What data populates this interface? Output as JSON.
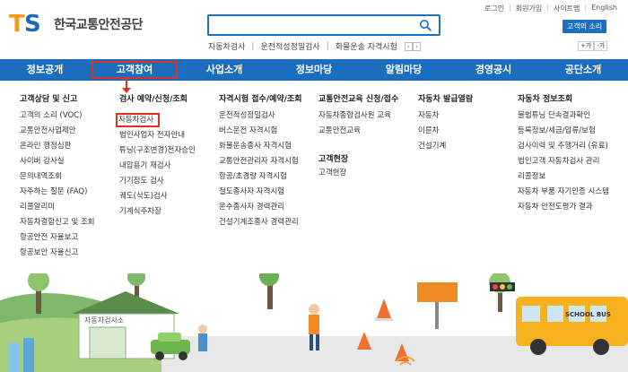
{
  "header": {
    "logo_mark_t": "T",
    "logo_mark_s": "S",
    "logo_text": "한국교통안전공단",
    "search_placeholder": "",
    "keywords": [
      "자동차검사",
      "운전적성정밀검사",
      "화물운송 자격시험"
    ],
    "util_links": [
      "로그인",
      "회원가입",
      "사이트맵",
      "English"
    ],
    "voice_button": "고객의 소리",
    "font_plus": "+가",
    "font_minus": "-가"
  },
  "nav": {
    "items": [
      "정보공개",
      "고객참여",
      "사업소개",
      "정보마당",
      "알림마당",
      "경영공시",
      "공단소개"
    ],
    "active_index": 1
  },
  "mega": {
    "col1": {
      "title": "고객상담 및 신고",
      "items": [
        "고객의 소리 (VOC)",
        "교통안전사업제안",
        "온라인 행정심판",
        "사이버 감사실",
        "문의내역조회",
        "자주하는 질문 (FAQ)",
        "리콜알리미",
        "자동차결함신고 및 조회",
        "항공안전 자율보고",
        "항공보안 자율신고"
      ]
    },
    "col2": {
      "title": "검사 예약/신청/조회",
      "items": [
        "자동차검사",
        "법인사업자 전자안내",
        "튜닝(구조변경)전자승인",
        "내압용기 재검사",
        "기기정도 검사",
        "궤도(삭도)검사",
        "기계식주차장"
      ]
    },
    "col3": {
      "title": "자격시험 접수/예약/조회",
      "items": [
        "운전적성정밀검사",
        "버스운전 자격시험",
        "화물운송종사 자격시험",
        "교통안전관리자 자격시험",
        "항공/초경량 자격시험",
        "철도종사자 자격시험",
        "운수종사자 경력관리",
        "건설기계조종사 경력관리"
      ]
    },
    "col4": {
      "title": "교통안전교육 신청/접수",
      "items": [
        "자동차종합검사원 교육",
        "교통안전교육"
      ],
      "subtitle": "고객현장",
      "sub_items": [
        "고객현장"
      ]
    },
    "col5": {
      "title": "자동차 발급열람",
      "items": [
        "자동차",
        "이륜차",
        "건설기계"
      ]
    },
    "col6": {
      "title": "자동차 정보조회",
      "items": [
        "불법튜닝 단속결과확인",
        "등록정보/세금/압류/보험",
        "검사이력 및 주행거리 (유료)",
        "법인고객 자동차검사 관리",
        "리콜정보",
        "자동차 부품 자기인증 시스템",
        "자동차 안전도평가 결과"
      ]
    }
  },
  "banner": {
    "building_sign": "자동차검사소",
    "bus_sign": "SCHOOL BUS"
  },
  "colors": {
    "nav_blue": "#1d6dbf",
    "highlight_red": "#e0301e",
    "logo_orange": "#f29a1c",
    "logo_blue": "#1c6bb8"
  }
}
